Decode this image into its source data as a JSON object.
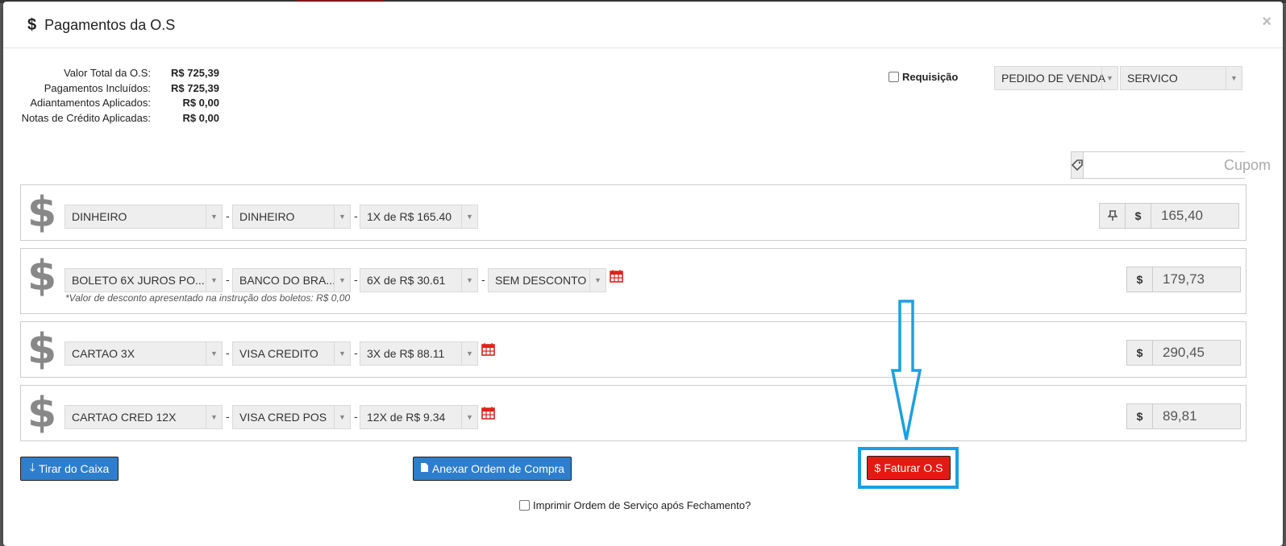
{
  "modal": {
    "title_icon": "$",
    "title": "Pagamentos da O.S",
    "close": "×"
  },
  "summary": [
    {
      "label": "Valor Total da O.S:",
      "value": "R$ 725,39"
    },
    {
      "label": "Pagamentos Incluídos:",
      "value": "R$ 725,39"
    },
    {
      "label": "Adiantamentos Aplicados:",
      "value": "R$ 0,00"
    },
    {
      "label": "Notas de Crédito Aplicadas:",
      "value": "R$ 0,00"
    }
  ],
  "requisicao": {
    "label": "Requisição",
    "checked": false
  },
  "top_selects": {
    "tipo": "PEDIDO DE VENDA",
    "categoria": "SERVICO"
  },
  "cupom": {
    "placeholder": "Cupom",
    "icon": "tag-icon"
  },
  "payments": [
    {
      "forma": "DINHEIRO",
      "conta": "DINHEIRO",
      "parcelas": "1X de R$ 165.40",
      "desconto": null,
      "amount": "165,40",
      "pinned": true,
      "note": null
    },
    {
      "forma": "BOLETO 6X JUROS PO...",
      "conta": "BANCO DO BRA...",
      "parcelas": "6X de R$ 30.61",
      "desconto": "SEM DESCONTO",
      "amount": "179,73",
      "pinned": false,
      "note": "*Valor de desconto apresentado na instrução dos boletos: R$ 0,00"
    },
    {
      "forma": "CARTAO 3X",
      "conta": "VISA CREDITO",
      "parcelas": "3X de R$ 88.11",
      "desconto": null,
      "amount": "290,45",
      "pinned": false,
      "note": null
    },
    {
      "forma": "CARTAO CRED 12X",
      "conta": "VISA CRED POS",
      "parcelas": "12X de R$ 9.34",
      "desconto": null,
      "amount": "89,81",
      "pinned": false,
      "note": null
    }
  ],
  "currency_addon": "$",
  "buttons": {
    "tirar_caixa": "Tirar do Caixa",
    "anexar": "Anexar Ordem de Compra",
    "faturar": "Faturar O.S"
  },
  "print_option": {
    "label": "Imprimir Ordem de Serviço após Fechamento?",
    "checked": false
  },
  "colors": {
    "primary": "#2d7ecd",
    "danger": "#e31a12",
    "annotation": "#1aa0e2"
  }
}
